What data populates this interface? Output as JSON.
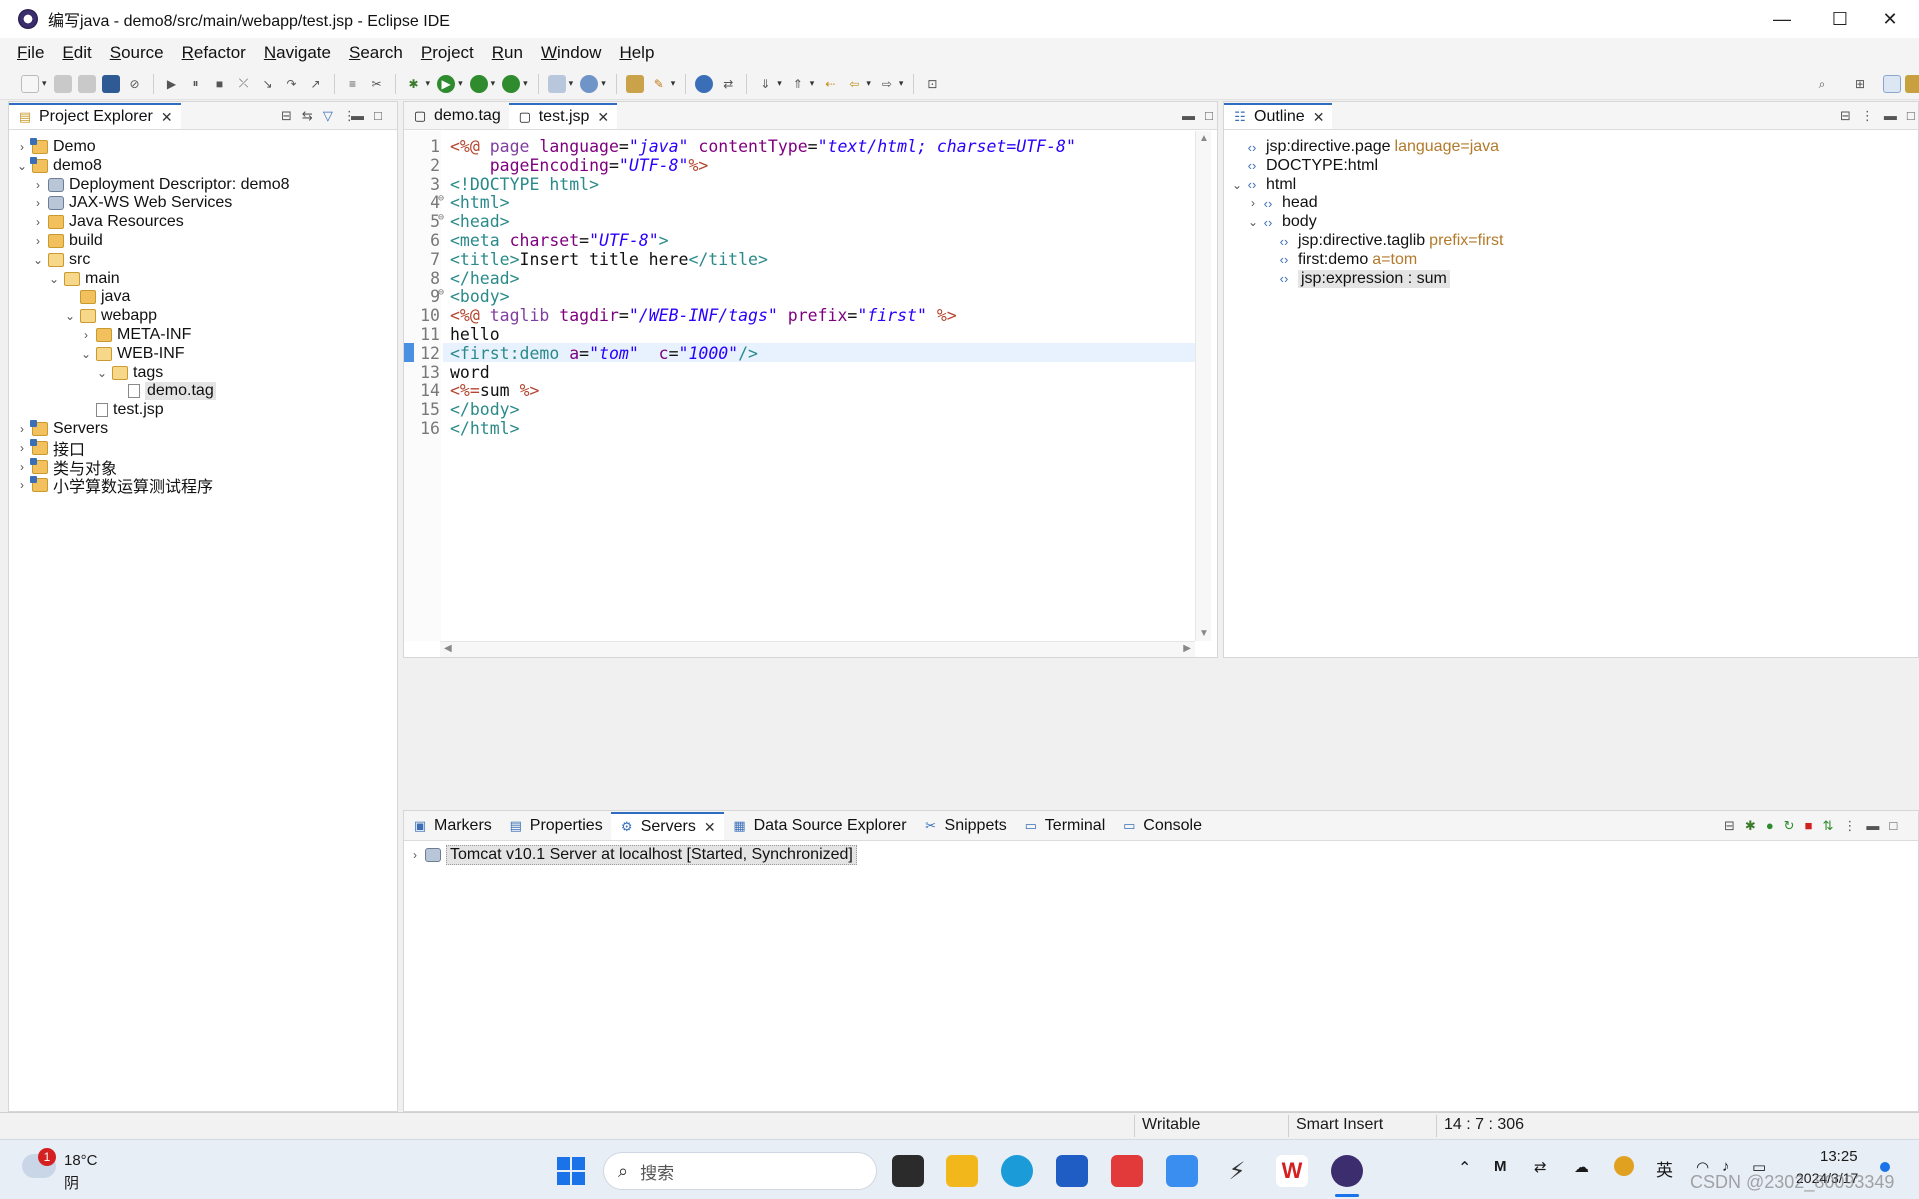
{
  "window": {
    "title": "编写java - demo8/src/main/webapp/test.jsp - Eclipse IDE"
  },
  "menu": [
    "File",
    "Edit",
    "Source",
    "Refactor",
    "Navigate",
    "Search",
    "Project",
    "Run",
    "Window",
    "Help"
  ],
  "project_explorer": {
    "tab_label": "Project Explorer",
    "tree": [
      {
        "label": "Demo",
        "level": 0,
        "expanded": false,
        "icon": "project-icon"
      },
      {
        "label": "demo8",
        "level": 0,
        "expanded": true,
        "icon": "project-icon"
      },
      {
        "label": "Deployment Descriptor: demo8",
        "level": 1,
        "expanded": false,
        "icon": "descriptor-icon"
      },
      {
        "label": "JAX-WS Web Services",
        "level": 1,
        "expanded": false,
        "icon": "webservice-icon"
      },
      {
        "label": "Java Resources",
        "level": 1,
        "expanded": false,
        "icon": "java-resources-icon"
      },
      {
        "label": "build",
        "level": 1,
        "expanded": false,
        "icon": "folder-icon"
      },
      {
        "label": "src",
        "level": 1,
        "expanded": true,
        "icon": "folder-open-icon"
      },
      {
        "label": "main",
        "level": 2,
        "expanded": true,
        "icon": "folder-open-icon"
      },
      {
        "label": "java",
        "level": 3,
        "expanded": null,
        "icon": "folder-icon"
      },
      {
        "label": "webapp",
        "level": 3,
        "expanded": true,
        "icon": "folder-open-icon"
      },
      {
        "label": "META-INF",
        "level": 4,
        "expanded": false,
        "icon": "folder-icon"
      },
      {
        "label": "WEB-INF",
        "level": 4,
        "expanded": true,
        "icon": "folder-open-icon"
      },
      {
        "label": "tags",
        "level": 5,
        "expanded": true,
        "icon": "folder-open-icon"
      },
      {
        "label": "demo.tag",
        "level": 6,
        "expanded": null,
        "icon": "file-icon",
        "selected": true
      },
      {
        "label": "test.jsp",
        "level": 4,
        "expanded": null,
        "icon": "file-icon"
      },
      {
        "label": "Servers",
        "level": 0,
        "expanded": false,
        "icon": "project-icon"
      },
      {
        "label": "接口",
        "level": 0,
        "expanded": false,
        "icon": "project-icon"
      },
      {
        "label": "类与对象",
        "level": 0,
        "expanded": false,
        "icon": "project-icon"
      },
      {
        "label": "小学算数运算测试程序",
        "level": 0,
        "expanded": false,
        "icon": "project-icon"
      }
    ]
  },
  "editor": {
    "tabs": [
      {
        "label": "demo.tag",
        "active": false
      },
      {
        "label": "test.jsp",
        "active": true
      }
    ],
    "lines": [
      {
        "n": "1",
        "fold": "",
        "parts": [
          [
            "jsp",
            "<%@ "
          ],
          [
            "kw",
            "page "
          ],
          [
            "attr",
            "language"
          ],
          [
            "text",
            "="
          ],
          [
            "str",
            "\"java\""
          ],
          [
            "text",
            " "
          ],
          [
            "attr",
            "contentType"
          ],
          [
            "text",
            "="
          ],
          [
            "str",
            "\"text/html; charset=UTF-8\""
          ]
        ]
      },
      {
        "n": "2",
        "fold": "",
        "parts": [
          [
            "text",
            "    "
          ],
          [
            "attr",
            "pageEncoding"
          ],
          [
            "text",
            "="
          ],
          [
            "str",
            "\"UTF-8\""
          ],
          [
            "jsp",
            "%>"
          ]
        ]
      },
      {
        "n": "3",
        "fold": "",
        "parts": [
          [
            "tag",
            "<!DOCTYPE html>"
          ]
        ]
      },
      {
        "n": "4",
        "fold": "⊖",
        "parts": [
          [
            "tag",
            "<html>"
          ]
        ]
      },
      {
        "n": "5",
        "fold": "⊖",
        "parts": [
          [
            "tag",
            "<head>"
          ]
        ]
      },
      {
        "n": "6",
        "fold": "",
        "parts": [
          [
            "tag",
            "<meta "
          ],
          [
            "attr",
            "charset"
          ],
          [
            "text",
            "="
          ],
          [
            "str",
            "\"UTF-8\""
          ],
          [
            "tag",
            ">"
          ]
        ]
      },
      {
        "n": "7",
        "fold": "",
        "parts": [
          [
            "tag",
            "<title>"
          ],
          [
            "text",
            "Insert title here"
          ],
          [
            "tag",
            "</title>"
          ]
        ]
      },
      {
        "n": "8",
        "fold": "",
        "parts": [
          [
            "tag",
            "</head>"
          ]
        ]
      },
      {
        "n": "9",
        "fold": "⊖",
        "parts": [
          [
            "tag",
            "<body>"
          ]
        ]
      },
      {
        "n": "10",
        "fold": "",
        "parts": [
          [
            "jsp",
            "<%@ "
          ],
          [
            "kw",
            "taglib "
          ],
          [
            "attr",
            "tagdir"
          ],
          [
            "text",
            "="
          ],
          [
            "str",
            "\"/WEB-INF/tags\""
          ],
          [
            "text",
            " "
          ],
          [
            "attr",
            "prefix"
          ],
          [
            "text",
            "="
          ],
          [
            "str",
            "\"first\""
          ],
          [
            "text",
            " "
          ],
          [
            "jsp",
            "%>"
          ]
        ]
      },
      {
        "n": "11",
        "fold": "",
        "parts": [
          [
            "text",
            "hello"
          ]
        ]
      },
      {
        "n": "12",
        "fold": "",
        "parts": [
          [
            "tag",
            "<first:demo "
          ],
          [
            "attr",
            "a"
          ],
          [
            "text",
            "="
          ],
          [
            "str",
            "\"tom\""
          ],
          [
            "text",
            "  "
          ],
          [
            "attr",
            "c"
          ],
          [
            "text",
            "="
          ],
          [
            "str",
            "\"1000\""
          ],
          [
            "tag",
            "/>"
          ]
        ]
      },
      {
        "n": "13",
        "fold": "",
        "parts": [
          [
            "text",
            "word"
          ]
        ]
      },
      {
        "n": "14",
        "fold": "",
        "parts": [
          [
            "jsp",
            "<%="
          ],
          [
            "text",
            "sum "
          ],
          [
            "jsp",
            "%>"
          ]
        ],
        "current": true
      },
      {
        "n": "15",
        "fold": "",
        "parts": [
          [
            "tag",
            "</body>"
          ]
        ]
      },
      {
        "n": "16",
        "fold": "",
        "parts": [
          [
            "tag",
            "</html>"
          ]
        ]
      }
    ]
  },
  "outline": {
    "tab_label": "Outline",
    "rows": [
      {
        "label": "jsp:directive.page",
        "extra": "language=java",
        "level": 0,
        "twist": ""
      },
      {
        "label": "DOCTYPE:html",
        "extra": "",
        "level": 0,
        "twist": ""
      },
      {
        "label": "html",
        "extra": "",
        "level": 0,
        "twist": "⌄"
      },
      {
        "label": "head",
        "extra": "",
        "level": 1,
        "twist": "›"
      },
      {
        "label": "body",
        "extra": "",
        "level": 1,
        "twist": "⌄"
      },
      {
        "label": "jsp:directive.taglib",
        "extra": "prefix=first",
        "level": 2,
        "twist": ""
      },
      {
        "label": "first:demo",
        "extra": "a=tom",
        "level": 2,
        "twist": ""
      },
      {
        "label": "jsp:expression : sum",
        "extra": "",
        "level": 2,
        "twist": "",
        "selected": true
      }
    ]
  },
  "bottom": {
    "tabs": [
      {
        "label": "Markers",
        "icon": "markers-icon",
        "closable": false
      },
      {
        "label": "Properties",
        "icon": "properties-icon",
        "closable": false
      },
      {
        "label": "Servers",
        "icon": "servers-icon",
        "closable": true,
        "active": true
      },
      {
        "label": "Data Source Explorer",
        "icon": "datasource-icon",
        "closable": false
      },
      {
        "label": "Snippets",
        "icon": "snippets-icon",
        "closable": false
      },
      {
        "label": "Terminal",
        "icon": "terminal-icon",
        "closable": false
      },
      {
        "label": "Console",
        "icon": "console-icon",
        "closable": false
      }
    ],
    "server_row": "Tomcat v10.1 Server at localhost  [Started, Synchronized]"
  },
  "status": {
    "writable": "Writable",
    "insert_mode": "Smart Insert",
    "position": "14 : 7 : 306"
  },
  "taskbar": {
    "weather_temp": "18°C",
    "weather_cond": "阴",
    "weather_badge": "1",
    "search_placeholder": "搜索",
    "time": "13:25",
    "date": "2024/3/17",
    "ime": "英",
    "watermark": "CSDN @2302_80093349"
  }
}
